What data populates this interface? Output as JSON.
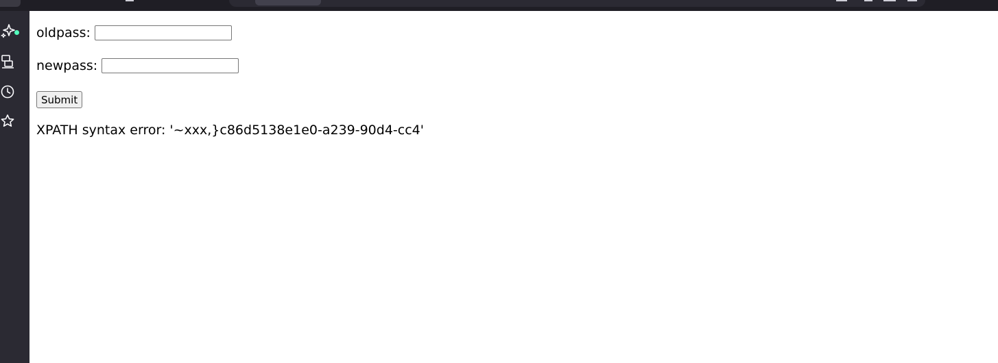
{
  "form": {
    "oldpass_label": "oldpass:",
    "oldpass_value": "",
    "newpass_label": "newpass:",
    "newpass_value": "",
    "submit_label": "Submit"
  },
  "message": {
    "error_text": "XPATH syntax error: '~xxx,}c86d5138e1e0-a239-90d4-cc4'"
  },
  "sidebar": {
    "icons": [
      "ai-sparkle-icon",
      "synced-tabs-icon",
      "history-icon",
      "bookmark-star-icon"
    ],
    "notify_color": "#54ffbd"
  }
}
